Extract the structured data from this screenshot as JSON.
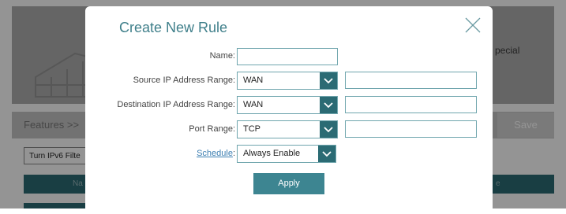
{
  "background": {
    "header_text": "pecial",
    "features_label": "Features >>",
    "save_label": "Save",
    "ipv6_select_value": "Turn IPv6 Filte",
    "table_header_left": "Na",
    "table_header_right": "e"
  },
  "modal": {
    "title": "Create New Rule",
    "name": {
      "label": "Name:",
      "value": ""
    },
    "source_ip": {
      "label": "Source IP Address Range:",
      "select_value": "WAN",
      "input_value": ""
    },
    "destination_ip": {
      "label": "Destination IP Address Range:",
      "select_value": "WAN",
      "input_value": ""
    },
    "port_range": {
      "label": "Port Range:",
      "select_value": "TCP",
      "input_value": ""
    },
    "schedule": {
      "link_label": "Schedule",
      "colon": ":",
      "select_value": "Always Enable"
    },
    "apply_label": "Apply"
  },
  "colors": {
    "accent": "#3f7f8a",
    "teal_dark": "#2b6b74",
    "apply": "#3d8591",
    "link": "#3d7fb2"
  },
  "icons": {
    "close": "close-x-icon",
    "dropdown": "chevron-down-icon"
  }
}
